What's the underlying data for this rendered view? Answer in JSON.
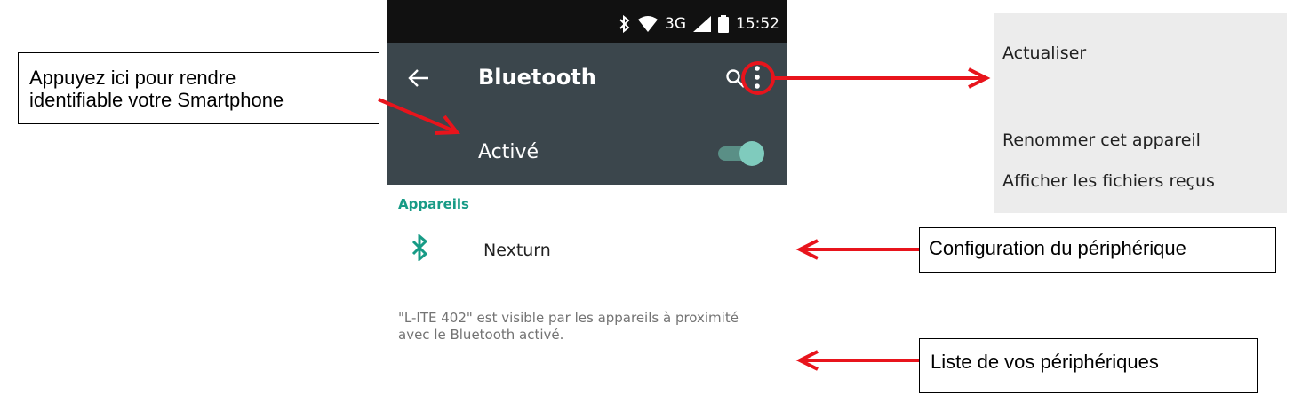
{
  "status_bar": {
    "network": "3G",
    "time": "15:52"
  },
  "app_bar": {
    "title": "Bluetooth"
  },
  "switch": {
    "label": "Activé",
    "state": "on"
  },
  "devices": {
    "section_title": "Appareils",
    "items": [
      {
        "name": "Nexturn"
      }
    ]
  },
  "visibility_text": "\"L-ITE 402\" est visible par les appareils à proximité avec le Bluetooth activé.",
  "menu": {
    "items": [
      {
        "label": "Actualiser"
      },
      {
        "label": "Renommer cet appareil"
      },
      {
        "label": "Afficher les fichiers reçus"
      }
    ]
  },
  "callouts": {
    "identify_line1": "Appuyez ici pour rendre",
    "identify_line2": "identifiable votre Smartphone",
    "device_config": "Configuration du périphérique",
    "device_list": "Liste de vos périphériques"
  },
  "colors": {
    "accent": "#179b86",
    "app_bar": "#3b464c",
    "annotation": "#e8141c"
  },
  "icons": [
    "bluetooth-icon",
    "wifi-icon",
    "signal-icon",
    "battery-icon",
    "back-arrow-icon",
    "search-icon",
    "overflow-menu-icon"
  ]
}
